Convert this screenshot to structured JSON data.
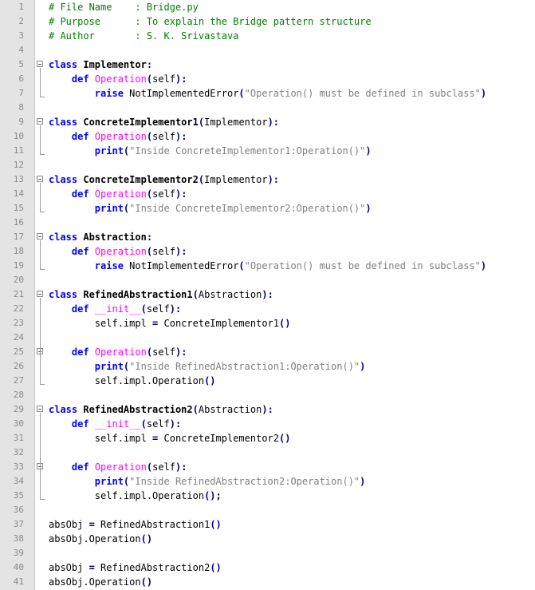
{
  "editor": {
    "lines": [
      {
        "n": "1",
        "tokens": [
          [
            "comment",
            "# File Name    : Bridge.py"
          ]
        ]
      },
      {
        "n": "2",
        "tokens": [
          [
            "comment",
            "# Purpose      : To explain the Bridge pattern structure"
          ]
        ]
      },
      {
        "n": "3",
        "tokens": [
          [
            "comment",
            "# Author       : S. K. Srivastava"
          ]
        ]
      },
      {
        "n": "4",
        "tokens": []
      },
      {
        "n": "5",
        "tokens": [
          [
            "kw",
            "class"
          ],
          [
            "txt",
            " "
          ],
          [
            "cls",
            "Implementor"
          ],
          [
            "op",
            ":"
          ]
        ]
      },
      {
        "n": "6",
        "tokens": [
          [
            "txt",
            "    "
          ],
          [
            "kw",
            "def"
          ],
          [
            "txt",
            " "
          ],
          [
            "fn",
            "Operation"
          ],
          [
            "op",
            "("
          ],
          [
            "txt",
            "self"
          ],
          [
            "op",
            "):"
          ]
        ]
      },
      {
        "n": "7",
        "tokens": [
          [
            "txt",
            "        "
          ],
          [
            "kw",
            "raise"
          ],
          [
            "txt",
            " NotImplementedError"
          ],
          [
            "op",
            "("
          ],
          [
            "str",
            "\"Operation() must be defined in subclass\""
          ],
          [
            "op",
            ")"
          ]
        ]
      },
      {
        "n": "8",
        "tokens": []
      },
      {
        "n": "9",
        "tokens": [
          [
            "kw",
            "class"
          ],
          [
            "txt",
            " "
          ],
          [
            "cls",
            "ConcreteImplementor1"
          ],
          [
            "op",
            "("
          ],
          [
            "txt",
            "Implementor"
          ],
          [
            "op",
            "):"
          ]
        ]
      },
      {
        "n": "10",
        "tokens": [
          [
            "txt",
            "    "
          ],
          [
            "kw",
            "def"
          ],
          [
            "txt",
            " "
          ],
          [
            "fn",
            "Operation"
          ],
          [
            "op",
            "("
          ],
          [
            "txt",
            "self"
          ],
          [
            "op",
            "):"
          ]
        ]
      },
      {
        "n": "11",
        "tokens": [
          [
            "txt",
            "        "
          ],
          [
            "kw",
            "print"
          ],
          [
            "op",
            "("
          ],
          [
            "str",
            "\"Inside ConcreteImplementor1:Operation()\""
          ],
          [
            "op",
            ")"
          ]
        ]
      },
      {
        "n": "12",
        "tokens": []
      },
      {
        "n": "13",
        "tokens": [
          [
            "kw",
            "class"
          ],
          [
            "txt",
            " "
          ],
          [
            "cls",
            "ConcreteImplementor2"
          ],
          [
            "op",
            "("
          ],
          [
            "txt",
            "Implementor"
          ],
          [
            "op",
            "):"
          ]
        ]
      },
      {
        "n": "14",
        "tokens": [
          [
            "txt",
            "    "
          ],
          [
            "kw",
            "def"
          ],
          [
            "txt",
            " "
          ],
          [
            "fn",
            "Operation"
          ],
          [
            "op",
            "("
          ],
          [
            "txt",
            "self"
          ],
          [
            "op",
            "):"
          ]
        ]
      },
      {
        "n": "15",
        "tokens": [
          [
            "txt",
            "        "
          ],
          [
            "kw",
            "print"
          ],
          [
            "op",
            "("
          ],
          [
            "str",
            "\"Inside ConcreteImplementor2:Operation()\""
          ],
          [
            "op",
            ")"
          ]
        ]
      },
      {
        "n": "16",
        "tokens": []
      },
      {
        "n": "17",
        "tokens": [
          [
            "kw",
            "class"
          ],
          [
            "txt",
            " "
          ],
          [
            "cls",
            "Abstraction"
          ],
          [
            "op",
            ":"
          ]
        ]
      },
      {
        "n": "18",
        "tokens": [
          [
            "txt",
            "    "
          ],
          [
            "kw",
            "def"
          ],
          [
            "txt",
            " "
          ],
          [
            "fn",
            "Operation"
          ],
          [
            "op",
            "("
          ],
          [
            "txt",
            "self"
          ],
          [
            "op",
            "):"
          ]
        ]
      },
      {
        "n": "19",
        "tokens": [
          [
            "txt",
            "        "
          ],
          [
            "kw",
            "raise"
          ],
          [
            "txt",
            " NotImplementedError"
          ],
          [
            "op",
            "("
          ],
          [
            "str",
            "\"Operation() must be defined in subclass\""
          ],
          [
            "op",
            ")"
          ]
        ]
      },
      {
        "n": "20",
        "tokens": []
      },
      {
        "n": "21",
        "tokens": [
          [
            "kw",
            "class"
          ],
          [
            "txt",
            " "
          ],
          [
            "cls",
            "RefinedAbstraction1"
          ],
          [
            "op",
            "("
          ],
          [
            "txt",
            "Abstraction"
          ],
          [
            "op",
            "):"
          ]
        ]
      },
      {
        "n": "22",
        "tokens": [
          [
            "txt",
            "    "
          ],
          [
            "kw",
            "def"
          ],
          [
            "txt",
            " "
          ],
          [
            "fn",
            "__init__"
          ],
          [
            "op",
            "("
          ],
          [
            "txt",
            "self"
          ],
          [
            "op",
            "):"
          ]
        ]
      },
      {
        "n": "23",
        "tokens": [
          [
            "txt",
            "        self.impl "
          ],
          [
            "op",
            "="
          ],
          [
            "txt",
            " ConcreteImplementor1"
          ],
          [
            "op",
            "()"
          ]
        ]
      },
      {
        "n": "24",
        "tokens": []
      },
      {
        "n": "25",
        "tokens": [
          [
            "txt",
            "    "
          ],
          [
            "kw",
            "def"
          ],
          [
            "txt",
            " "
          ],
          [
            "fn",
            "Operation"
          ],
          [
            "op",
            "("
          ],
          [
            "txt",
            "self"
          ],
          [
            "op",
            "):"
          ]
        ]
      },
      {
        "n": "26",
        "tokens": [
          [
            "txt",
            "        "
          ],
          [
            "kw",
            "print"
          ],
          [
            "op",
            "("
          ],
          [
            "str",
            "\"Inside RefinedAbstraction1:Operation()\""
          ],
          [
            "op",
            ")"
          ]
        ]
      },
      {
        "n": "27",
        "tokens": [
          [
            "txt",
            "        self.impl.Operation"
          ],
          [
            "op",
            "()"
          ]
        ]
      },
      {
        "n": "28",
        "tokens": []
      },
      {
        "n": "29",
        "tokens": [
          [
            "kw",
            "class"
          ],
          [
            "txt",
            " "
          ],
          [
            "cls",
            "RefinedAbstraction2"
          ],
          [
            "op",
            "("
          ],
          [
            "txt",
            "Abstraction"
          ],
          [
            "op",
            "):"
          ]
        ]
      },
      {
        "n": "30",
        "tokens": [
          [
            "txt",
            "    "
          ],
          [
            "kw",
            "def"
          ],
          [
            "txt",
            " "
          ],
          [
            "fn",
            "__init__"
          ],
          [
            "op",
            "("
          ],
          [
            "txt",
            "self"
          ],
          [
            "op",
            "):"
          ]
        ]
      },
      {
        "n": "31",
        "tokens": [
          [
            "txt",
            "        self.impl "
          ],
          [
            "op",
            "="
          ],
          [
            "txt",
            " ConcreteImplementor2"
          ],
          [
            "op",
            "()"
          ]
        ]
      },
      {
        "n": "32",
        "tokens": []
      },
      {
        "n": "33",
        "tokens": [
          [
            "txt",
            "    "
          ],
          [
            "kw",
            "def"
          ],
          [
            "txt",
            " "
          ],
          [
            "fn",
            "Operation"
          ],
          [
            "op",
            "("
          ],
          [
            "txt",
            "self"
          ],
          [
            "op",
            "):"
          ]
        ]
      },
      {
        "n": "34",
        "tokens": [
          [
            "txt",
            "        "
          ],
          [
            "kw",
            "print"
          ],
          [
            "op",
            "("
          ],
          [
            "str",
            "\"Inside RefinedAbstraction2:Operation()\""
          ],
          [
            "op",
            ")"
          ]
        ]
      },
      {
        "n": "35",
        "tokens": [
          [
            "txt",
            "        self.impl.Operation"
          ],
          [
            "op",
            "();"
          ]
        ]
      },
      {
        "n": "36",
        "tokens": []
      },
      {
        "n": "37",
        "tokens": [
          [
            "txt",
            "absObj "
          ],
          [
            "op",
            "="
          ],
          [
            "txt",
            " RefinedAbstraction1"
          ],
          [
            "op",
            "()"
          ]
        ]
      },
      {
        "n": "38",
        "tokens": [
          [
            "txt",
            "absObj.Operation"
          ],
          [
            "op",
            "()"
          ]
        ]
      },
      {
        "n": "39",
        "tokens": []
      },
      {
        "n": "40",
        "tokens": [
          [
            "txt",
            "absObj "
          ],
          [
            "op",
            "="
          ],
          [
            "txt",
            " RefinedAbstraction2"
          ],
          [
            "op",
            "()"
          ]
        ]
      },
      {
        "n": "41",
        "tokens": [
          [
            "txt",
            "absObj.Operation"
          ],
          [
            "op",
            "()"
          ]
        ]
      }
    ]
  }
}
